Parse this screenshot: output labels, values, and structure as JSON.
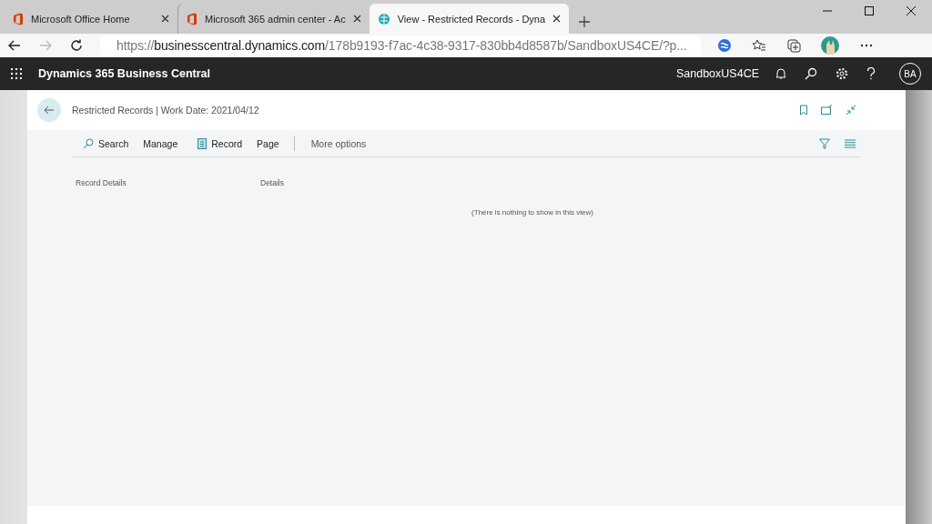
{
  "browser": {
    "tabs": [
      {
        "title": "Microsoft Office Home",
        "kind": "office",
        "selected": false
      },
      {
        "title": "Microsoft 365 admin center - Ac",
        "kind": "office",
        "selected": false
      },
      {
        "title": "View - Restricted Records - Dyna",
        "kind": "site",
        "selected": true
      }
    ],
    "url": {
      "scheme": "https://",
      "host": "businesscentral.dynamics.com",
      "path": "/178b9193-f7ac-4c38-9317-830bb4d8587b/SandboxUS4CE/?p..."
    }
  },
  "app_bar": {
    "title": "Dynamics 365 Business Central",
    "environment": "SandboxUS4CE",
    "user_initials": "BA"
  },
  "page": {
    "title": "Restricted Records | Work Date: 2021/04/12",
    "actions": [
      {
        "label": "Search",
        "kind": "search"
      },
      {
        "label": "Manage",
        "kind": "plain"
      },
      {
        "label": "Record",
        "kind": "record"
      },
      {
        "label": "Page",
        "kind": "plain"
      },
      {
        "label": "More options",
        "kind": "more"
      }
    ],
    "columns": [
      "Record Details",
      "Details"
    ],
    "empty_message": "(There is nothing to show in this view)"
  }
}
